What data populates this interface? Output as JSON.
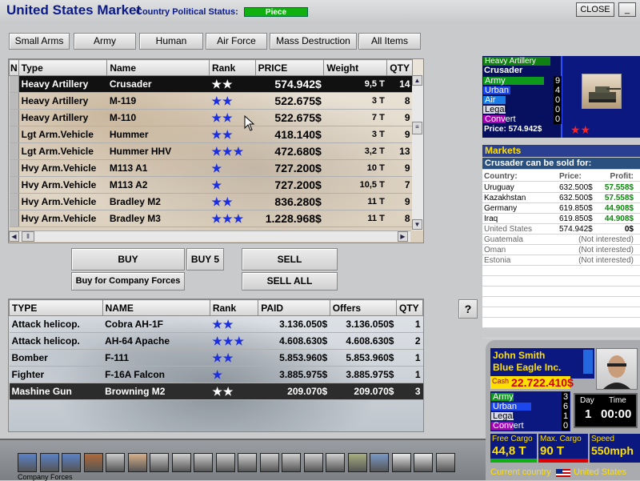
{
  "header": {
    "title": "United States Market",
    "subtitle": "Country Political Status:",
    "status": "Piece",
    "close_label": "CLOSE",
    "minimize_label": "_"
  },
  "categories": [
    "Small Arms",
    "Army",
    "Human",
    "Air Force",
    "Mass Destruction",
    "All Items"
  ],
  "market_table": {
    "columns": [
      "N",
      "Type",
      "Name",
      "Rank",
      "PRICE",
      "Weight",
      "QTY"
    ],
    "rows": [
      {
        "type": "Heavy Artillery",
        "name": "Crusader",
        "rank": "★★",
        "price": "574.942$",
        "weight": "9,5 T",
        "qty": "14"
      },
      {
        "type": "Heavy Artillery",
        "name": "M-119",
        "rank": "★★",
        "price": "522.675$",
        "weight": "3 T",
        "qty": "8"
      },
      {
        "type": "Heavy Artillery",
        "name": "M-110",
        "rank": "★★",
        "price": "522.675$",
        "weight": "7 T",
        "qty": "9"
      },
      {
        "type": "Lgt Arm.Vehicle",
        "name": "Hummer",
        "rank": "★★",
        "price": "418.140$",
        "weight": "3 T",
        "qty": "9"
      },
      {
        "type": "Lgt Arm.Vehicle",
        "name": "Hummer HHV",
        "rank": "★★★",
        "price": "472.680$",
        "weight": "3,2 T",
        "qty": "13"
      },
      {
        "type": "Hvy Arm.Vehicle",
        "name": "M113 A1",
        "rank": "★",
        "price": "727.200$",
        "weight": "10 T",
        "qty": "9"
      },
      {
        "type": "Hvy Arm.Vehicle",
        "name": "M113 A2",
        "rank": "★",
        "price": "727.200$",
        "weight": "10,5 T",
        "qty": "7"
      },
      {
        "type": "Hvy Arm.Vehicle",
        "name": "Bradley M2",
        "rank": "★★",
        "price": "836.280$",
        "weight": "11 T",
        "qty": "9"
      },
      {
        "type": "Hvy Arm.Vehicle",
        "name": "Bradley M3",
        "rank": "★★★",
        "price": "1.228.968$",
        "weight": "11 T",
        "qty": "8"
      }
    ]
  },
  "actions": {
    "buy": "BUY",
    "buy5": "BUY 5",
    "sell": "SELL",
    "buy_company": "Buy for Company Forces",
    "sell_all": "SELL ALL",
    "help": "?"
  },
  "owned_table": {
    "columns": [
      "TYPE",
      "NAME",
      "Rank",
      "PAID",
      "Offers",
      "QTY"
    ],
    "rows": [
      {
        "type": "Attack helicop.",
        "name": "Cobra AH-1F",
        "rank": "★★",
        "paid": "3.136.050$",
        "offers": "3.136.050$",
        "qty": "1"
      },
      {
        "type": "Attack helicop.",
        "name": "AH-64 Apache",
        "rank": "★★★",
        "paid": "4.608.630$",
        "offers": "4.608.630$",
        "qty": "2"
      },
      {
        "type": "Bomber",
        "name": "F-111",
        "rank": "★★",
        "paid": "5.853.960$",
        "offers": "5.853.960$",
        "qty": "1"
      },
      {
        "type": "Fighter",
        "name": "F-16A Falcon",
        "rank": "★",
        "paid": "3.885.975$",
        "offers": "3.885.975$",
        "qty": "1"
      },
      {
        "type": "Mashine Gun",
        "name": "Browning M2",
        "rank": "★★",
        "paid": "209.070$",
        "offers": "209.070$",
        "qty": "3"
      }
    ]
  },
  "item_info": {
    "category": "Heavy Artillery",
    "name": "Crusader",
    "stats": [
      {
        "label": "Army",
        "value": "9",
        "color": "#10b010",
        "fill": 0.9
      },
      {
        "label": "Urban",
        "value": "4",
        "color": "#2050ff",
        "fill": 0.4
      },
      {
        "label": "Air",
        "value": "0",
        "color": "#2090ff",
        "fill": 0.0
      },
      {
        "label": "Legal",
        "value": "0",
        "color": "#ffffff",
        "fill": 0.0
      },
      {
        "label": "Convert",
        "value": "0",
        "color": "#c000c0",
        "fill": 0.0
      }
    ],
    "price": "Price: 574.942$",
    "rank": "★★"
  },
  "markets": {
    "title": "Markets",
    "subtitle": "Crusader can be sold for:",
    "headers": {
      "country": "Country:",
      "price": "Price:",
      "profit": "Profit:"
    },
    "rows": [
      {
        "country": "Uruguay",
        "price": "632.500$",
        "profit": "57.558$"
      },
      {
        "country": "Kazakhstan",
        "price": "632.500$",
        "profit": "57.558$"
      },
      {
        "country": "Germany",
        "price": "619.850$",
        "profit": "44.908$"
      },
      {
        "country": "Iraq",
        "price": "619.850$",
        "profit": "44.908$"
      },
      {
        "country": "United States",
        "price": "574.942$",
        "profit": "0$"
      },
      {
        "country": "Guatemala",
        "price": "",
        "profit": "(Not interested)"
      },
      {
        "country": "Oman",
        "price": "",
        "profit": "(Not interested)"
      },
      {
        "country": "Estonia",
        "price": "",
        "profit": "(Not interested)"
      }
    ]
  },
  "player": {
    "name": "John Smith",
    "company": "Blue Eagle Inc.",
    "cash_label": "Cash",
    "cash": "22.722.410$",
    "stats": [
      {
        "label": "Army",
        "value": "3",
        "color": "#10b010",
        "fill": 0.3
      },
      {
        "label": "Urban",
        "value": "6",
        "color": "#2050ff",
        "fill": 0.6
      },
      {
        "label": "Legal",
        "value": "1",
        "color": "#ffffff",
        "fill": 0.1
      },
      {
        "label": "Convert",
        "value": "0",
        "color": "#c000c0",
        "fill": 0.0
      }
    ],
    "day_label": "Day",
    "day": "1",
    "time_label": "Time",
    "time": "00:00",
    "free_cargo_label": "Free Cargo",
    "free_cargo": "44,8 T",
    "max_cargo_label": "Max. Cargo",
    "max_cargo": "90 T",
    "speed_label": "Speed",
    "speed": "550mph",
    "country_label": "Current country",
    "country": "United States"
  },
  "company_forces_label": "Company  Forces"
}
